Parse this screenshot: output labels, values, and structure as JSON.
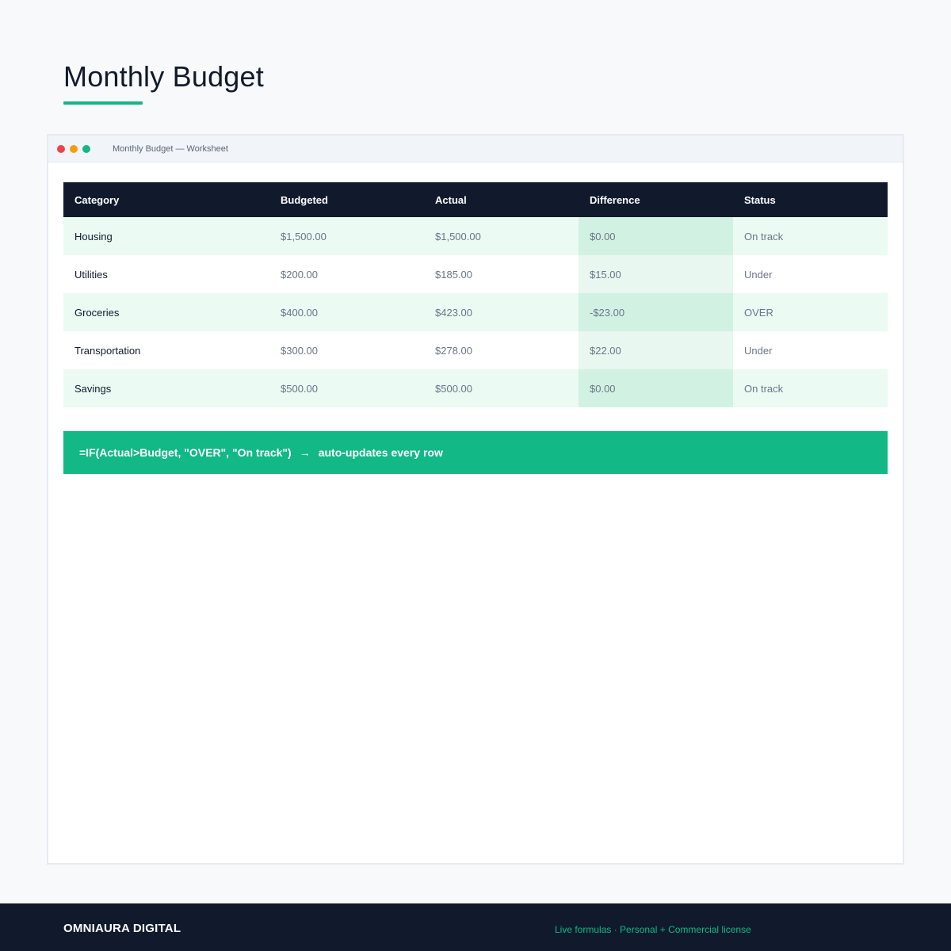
{
  "page": {
    "title": "Monthly Budget"
  },
  "window": {
    "title": "Monthly Budget — Worksheet"
  },
  "table": {
    "headers": [
      "Category",
      "Budgeted",
      "Actual",
      "Difference",
      "Status"
    ],
    "rows": [
      {
        "category": "Housing",
        "budgeted": "$1,500.00",
        "actual": "$1,500.00",
        "difference": "$0.00",
        "status": "On track"
      },
      {
        "category": "Utilities",
        "budgeted": "$200.00",
        "actual": "$185.00",
        "difference": "$15.00",
        "status": "Under"
      },
      {
        "category": "Groceries",
        "budgeted": "$400.00",
        "actual": "$423.00",
        "difference": "-$23.00",
        "status": "OVER"
      },
      {
        "category": "Transportation",
        "budgeted": "$300.00",
        "actual": "$278.00",
        "difference": "$22.00",
        "status": "Under"
      },
      {
        "category": "Savings",
        "budgeted": "$500.00",
        "actual": "$500.00",
        "difference": "$0.00",
        "status": "On track"
      }
    ]
  },
  "formula": {
    "expression": "=IF(Actual>Budget, \"OVER\", \"On track\")",
    "arrow": "→",
    "note": "auto-updates every row"
  },
  "footer": {
    "brand": "OMNIAURA DIGITAL",
    "tagline": "Live formulas · Personal + Commercial license"
  },
  "colors": {
    "accent": "#12b886",
    "dark": "#111a2c",
    "row_alt": "#ebfaf3",
    "diff_highlight": "#d1f2e3"
  }
}
